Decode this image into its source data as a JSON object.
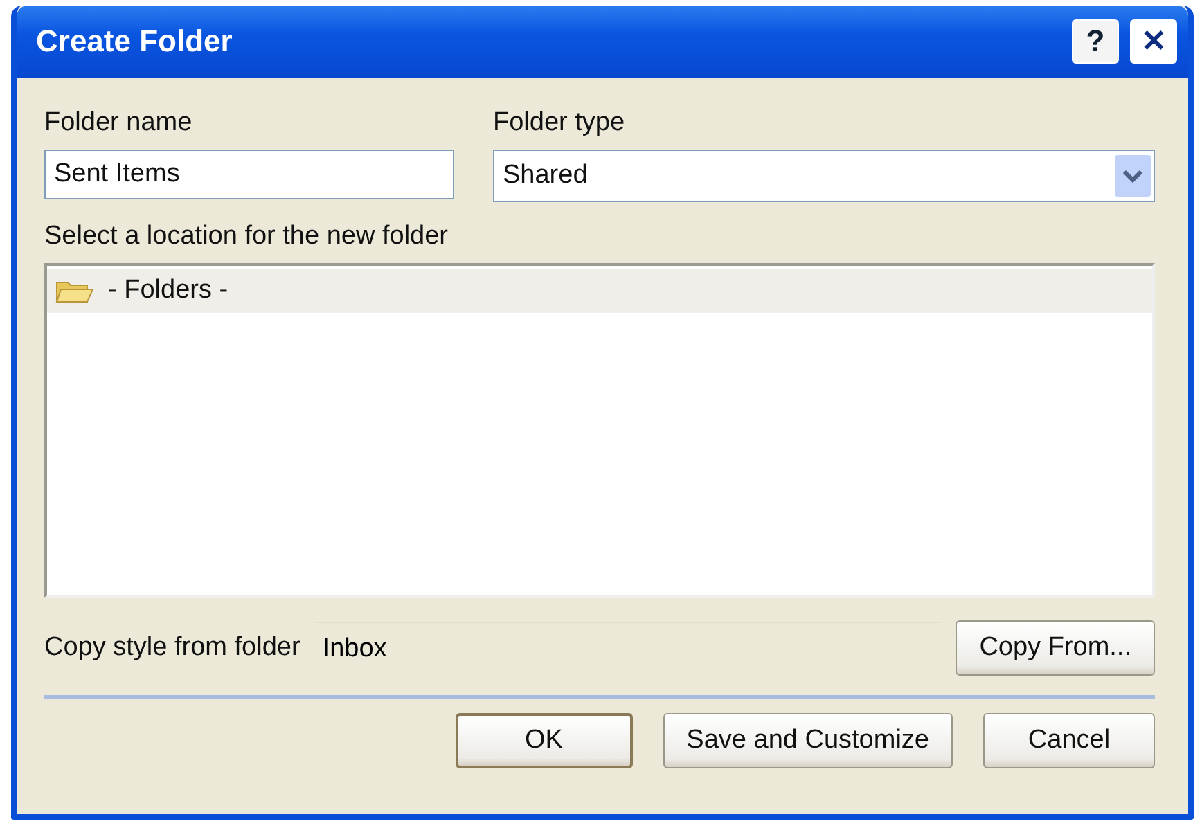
{
  "window": {
    "title": "Create Folder",
    "controls": [
      {
        "kind": "help",
        "label": "?"
      },
      {
        "kind": "close",
        "label": "✕"
      }
    ]
  },
  "folder_name": {
    "label": "Folder name",
    "value": "Sent Items"
  },
  "folder_type": {
    "label": "Folder type",
    "value": "Shared"
  },
  "location": {
    "label": "Select a location for the new folder",
    "items": [
      {
        "label": "- Folders -",
        "selected": true
      }
    ]
  },
  "copy_style": {
    "label": "Copy style from folder",
    "value": "Inbox",
    "button": "Copy From..."
  },
  "buttons": [
    {
      "label": "OK",
      "default": true
    },
    {
      "label": "Save and Customize",
      "default": false
    },
    {
      "label": "Cancel",
      "default": false
    }
  ]
}
